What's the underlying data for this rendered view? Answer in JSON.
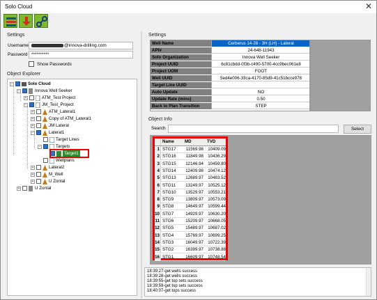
{
  "window": {
    "title": "Solo Cloud",
    "close_glyph": "✕"
  },
  "toolbar": [
    {
      "icon": "well-tree-icon"
    },
    {
      "icon": "download-arrow-icon"
    },
    {
      "icon": "link-icon"
    }
  ],
  "settings": {
    "group_label": "Settings",
    "username_label": "Username",
    "username_suffix": "@innova-drilling.com",
    "password_label": "Password",
    "password_value": "**********",
    "show_passwords_label": "Show Passwords"
  },
  "explorer": {
    "group_label": "Object Explorer",
    "items": [
      "Solo Cloud",
      "Innova Well Seeker",
      "ATM_Test Project",
      "JM_Test_Project",
      "ATM_Lateral1",
      "Copy of ATM_Lateral1",
      "JM Lateral",
      "Lateral1",
      "Target Lines",
      "Targets",
      "Target1",
      "Wellplans",
      "Lateral2",
      "M_Well",
      "U Zontal",
      "U Zontal"
    ]
  },
  "right_settings": {
    "group_label": "Settings",
    "rows": [
      {
        "key": "Well Name",
        "value": "Cerberus 14-28 - 3H (LH) - Lateral"
      },
      {
        "key": "API#",
        "value": "24-648-11943"
      },
      {
        "key": "Solo Organization",
        "value": "Innova Well Seeker"
      },
      {
        "key": "Project UUID",
        "value": "6c81cbdd-0f3b-c490-5700-4cc9bec061e8"
      },
      {
        "key": "Project UOM",
        "value": "FOOT"
      },
      {
        "key": "Well UUID",
        "value": "5ed4e006-33ca-4170-85d9-41c51bcce978"
      },
      {
        "key": "Target Line UUID",
        "value": ""
      },
      {
        "key": "Auto Update",
        "value": "NO"
      },
      {
        "key": "Update Rate (mins)",
        "value": "0.50"
      },
      {
        "key": "Back to Plan Transition",
        "value": "STEP"
      }
    ]
  },
  "object_info": {
    "group_label": "Object Info",
    "search_label": "Search",
    "select_button": "Select",
    "columns": [
      "Name",
      "MD",
      "TVD"
    ],
    "rows": [
      [
        "1",
        "STG17",
        "11569.98",
        "10409.09"
      ],
      [
        "2",
        "STG16",
        "11849.98",
        "10436.29"
      ],
      [
        "3",
        "STG15",
        "12146.94",
        "10459.80"
      ],
      [
        "4",
        "STG14",
        "12409.98",
        "10474.12"
      ],
      [
        "5",
        "STG13",
        "12689.97",
        "10483.52"
      ],
      [
        "6",
        "STG11",
        "13249.97",
        "10525.12"
      ],
      [
        "7",
        "STG10",
        "13529.97",
        "10553.21"
      ],
      [
        "8",
        "STG9",
        "13809.97",
        "10573.09"
      ],
      [
        "9",
        "STG8",
        "14649.97",
        "10599.44"
      ],
      [
        "10",
        "STG7",
        "14929.97",
        "10630.20"
      ],
      [
        "11",
        "STG6",
        "15209.97",
        "10668.05"
      ],
      [
        "12",
        "STG5",
        "15489.97",
        "10687.02"
      ],
      [
        "13",
        "STG4",
        "15769.97",
        "10699.25"
      ],
      [
        "14",
        "STG3",
        "16049.97",
        "10722.39"
      ],
      [
        "15",
        "STG2",
        "16399.97",
        "10738.88"
      ],
      [
        "16",
        "STG1",
        "16609.97",
        "10748.54"
      ]
    ]
  },
  "log": [
    "18:39:27-get wells success",
    "18:39:28-get wells success",
    "18:39:55-get top sets success",
    "18:39:59-get top sets success",
    "18:40:07-get tops success"
  ],
  "colors": {
    "accent": "#0a64c8",
    "highlight": "#e00000",
    "toolbar_green": "#7cba2e"
  }
}
